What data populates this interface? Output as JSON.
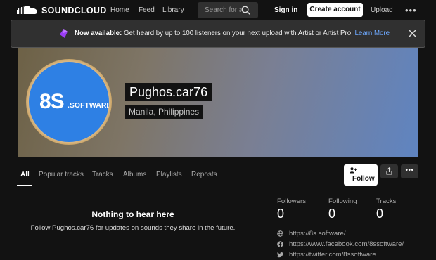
{
  "nav": {
    "brand": "SOUNDCLOUD",
    "home": "Home",
    "feed": "Feed",
    "library": "Library",
    "search_placeholder": "Search for a",
    "signin": "Sign in",
    "create_account": "Create account",
    "upload": "Upload",
    "more": "•••"
  },
  "banner": {
    "lead": "Now available:",
    "text": " Get heard by up to 100 listeners on your next upload with Artist or Artist Pro. ",
    "link": "Learn More"
  },
  "profile": {
    "username": "Pughos.car76",
    "location": "Manila, Philippines",
    "avatar_big": "8S",
    "avatar_small": ".SOFTWARE"
  },
  "tabs": [
    {
      "label": "All",
      "active": true
    },
    {
      "label": "Popular tracks"
    },
    {
      "label": "Tracks"
    },
    {
      "label": "Albums"
    },
    {
      "label": "Playlists"
    },
    {
      "label": "Reposts"
    }
  ],
  "actions": {
    "follow": "Follow",
    "more": "•••"
  },
  "empty": {
    "title": "Nothing to hear here",
    "subtitle": "Follow Pughos.car76 for updates on sounds they share in the future."
  },
  "stats": [
    {
      "label": "Followers",
      "value": "0"
    },
    {
      "label": "Following",
      "value": "0"
    },
    {
      "label": "Tracks",
      "value": "0"
    }
  ],
  "links": [
    {
      "icon": "globe-icon",
      "text": "https://8s.software/"
    },
    {
      "icon": "facebook-icon",
      "text": "https://www.facebook.com/8ssoftware/"
    },
    {
      "icon": "twitter-icon",
      "text": "https://twitter.com/8ssoftware"
    }
  ]
}
